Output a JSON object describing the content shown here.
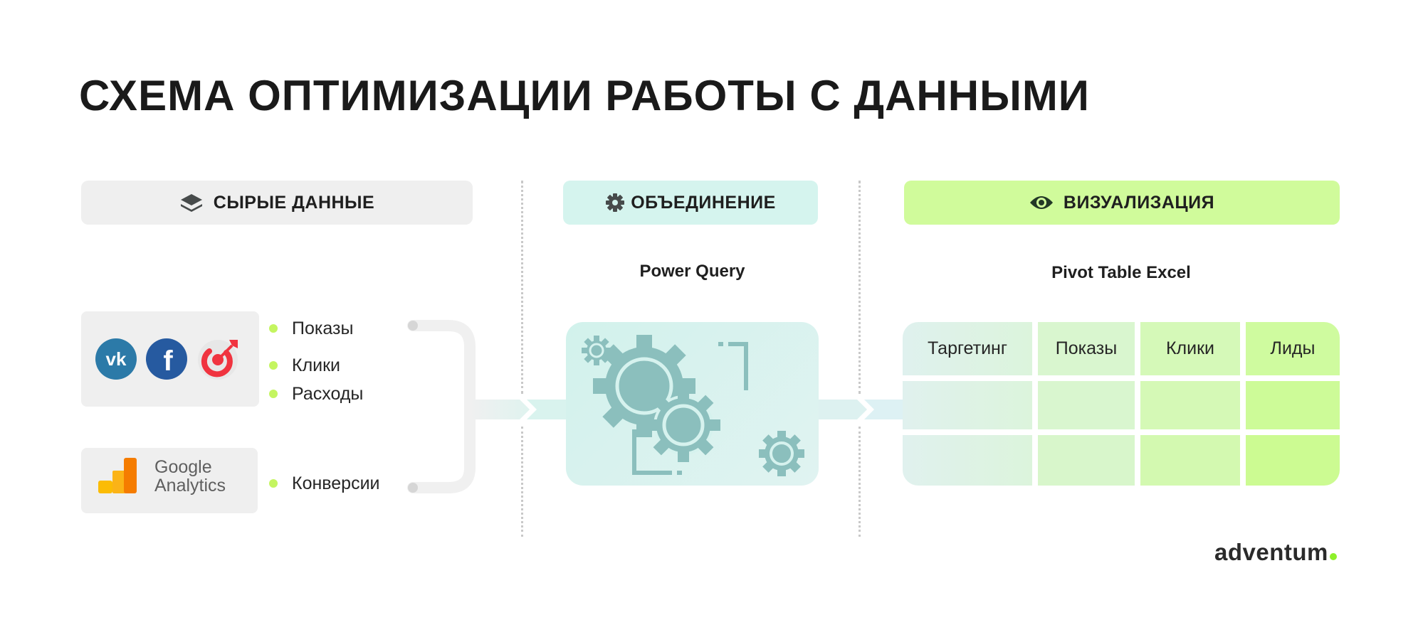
{
  "title": "СХЕМА ОПТИМИЗАЦИИ РАБОТЫ С ДАННЫМИ",
  "phases": [
    {
      "label": "СЫРЫЕ ДАННЫЕ",
      "icon": "layers-icon",
      "color": "#efefef"
    },
    {
      "label": "ОБЪЕДИНЕНИЕ",
      "icon": "gear-icon",
      "color": "#d5f4ee"
    },
    {
      "label": "ВИЗУАЛИЗАЦИЯ",
      "icon": "eye-icon",
      "color": "#d0fb9b"
    }
  ],
  "raw_data": {
    "sources": [
      {
        "name": "ad-platforms",
        "icons": [
          "vk-icon",
          "facebook-icon",
          "target-icon"
        ],
        "metrics": [
          "Показы",
          "Клики",
          "Расходы"
        ]
      },
      {
        "name": "google-analytics",
        "logo_text": [
          "Google",
          "Analytics"
        ],
        "metrics": [
          "Конверсии"
        ]
      }
    ]
  },
  "merge": {
    "tool": "Power Query",
    "icon": "gears-icon"
  },
  "visualization": {
    "tool": "Pivot Table Excel",
    "table": {
      "headers": [
        "Таргетинг",
        "Показы",
        "Клики",
        "Лиды"
      ],
      "rows": [
        [
          "",
          "",
          "",
          ""
        ],
        [
          "",
          "",
          "",
          ""
        ]
      ]
    }
  },
  "brand": {
    "name": "adventum",
    "accent": "#8ef02a"
  },
  "colors": {
    "bullet": "#c4f560",
    "connector": "#f0f0f0",
    "gear": "#8bbfbd"
  }
}
